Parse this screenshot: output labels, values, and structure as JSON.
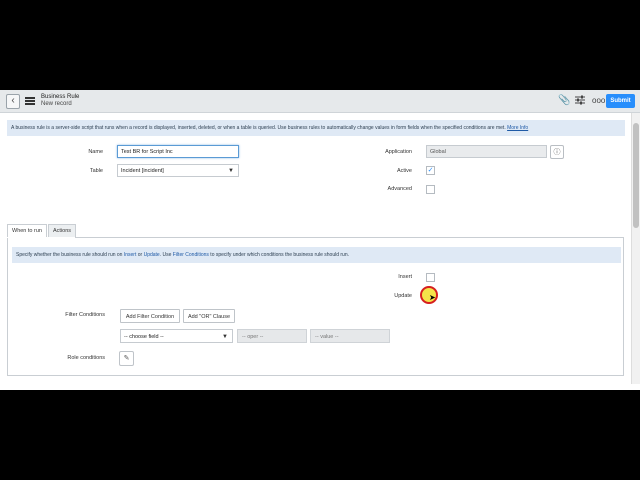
{
  "header": {
    "title": "Business Rule",
    "subtitle": "New record",
    "submit_label": "Submit",
    "icons": [
      "paperclip-icon",
      "sliders-icon",
      "more-icon"
    ]
  },
  "info_bar": {
    "text": "A business rule is a server-side script that runs when a record is displayed, inserted, deleted, or when a table is queried. Use business rules to automatically change values in form fields when the specified conditions are met. ",
    "link": "More Info"
  },
  "form": {
    "name_label": "Name",
    "name_value": "Test BR for Script Inc",
    "table_label": "Table",
    "table_value": "Incident [incident]",
    "application_label": "Application",
    "application_value": "Global",
    "active_label": "Active",
    "active_checked": true,
    "advanced_label": "Advanced",
    "advanced_checked": false
  },
  "tabs": [
    {
      "label": "When to run",
      "active": true
    },
    {
      "label": "Actions",
      "active": false
    }
  ],
  "when_to_run": {
    "info_pre": "Specify whether the business rule should run on ",
    "info_insert": "Insert",
    "info_or": " or ",
    "info_update": "Update",
    "info_mid": ". Use ",
    "info_filter": "Filter Conditions",
    "info_post": " to specify under which conditions the business rule should run.",
    "insert_label": "Insert",
    "update_label": "Update",
    "filter_label": "Filter Conditions",
    "add_filter_label": "Add Filter Condition",
    "add_or_label": "Add \"OR\" Clause",
    "choose_field": "-- choose field --",
    "oper": "-- oper --",
    "value": "-- value --",
    "role_label": "Role conditions"
  }
}
